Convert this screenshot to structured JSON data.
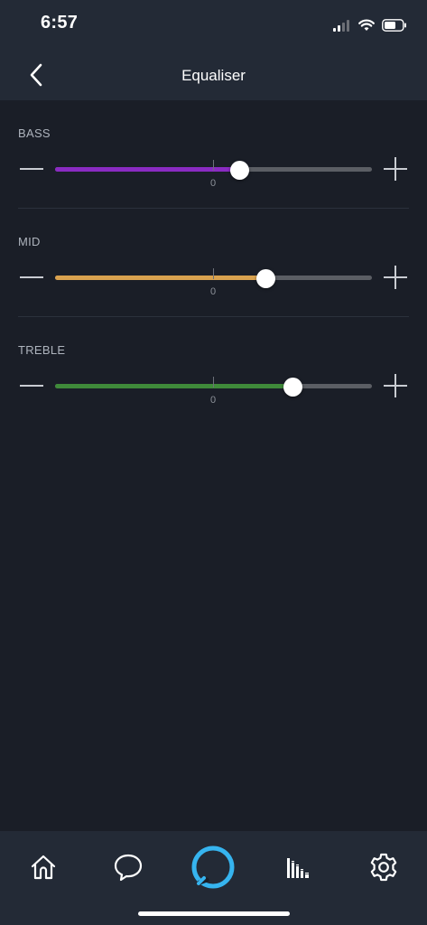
{
  "status_bar": {
    "time": "6:57"
  },
  "header": {
    "title": "Equaliser",
    "back_icon": "chevron-left-icon"
  },
  "equaliser": {
    "zero_label": "0",
    "bands": [
      {
        "label": "BASS",
        "value_fraction": 0.58,
        "color": "#8a2bc2"
      },
      {
        "label": "MID",
        "value_fraction": 0.665,
        "color": "#d9a24f"
      },
      {
        "label": "TREBLE",
        "value_fraction": 0.75,
        "color": "#3f8a3a"
      }
    ]
  },
  "bottom_nav": {
    "items": [
      "home-icon",
      "chat-icon",
      "alexa-icon",
      "play-icon",
      "settings-icon"
    ],
    "alexa_color": "#36b4ef"
  }
}
